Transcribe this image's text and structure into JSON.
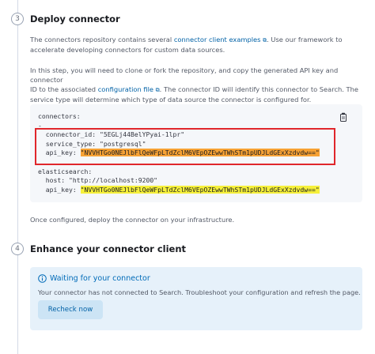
{
  "step3": {
    "number": "3",
    "title": "Deploy connector",
    "intro_part1": "The connectors repository contains several ",
    "intro_link": "connector client examples",
    "intro_part2": ". Use our framework to",
    "intro_line2": "accelerate developing connectors for custom data sources.",
    "para2_line1": "In this step, you will need to clone or fork the repository, and copy the generated API key and connector",
    "para2_line2_part1": "ID to the associated ",
    "para2_link": "configuration file",
    "para2_line2_part2": ". The connector ID will identify this connector to Search. The",
    "para2_line3": "service type will determine which type of data source the connector is configured for.",
    "code": {
      "l1": "connectors:",
      "l2": "-",
      "connector_id_key": "  connector_id: ",
      "connector_id_val": "\"5EGLj44BelYPyai-1lpr\"",
      "service_type_key": "  service_type: ",
      "service_type_val": "\"postgresql\"",
      "api_key_key": "  api_key: ",
      "api_key_val": "\"NVVHTGo0NEJlbFlQeWFpLTdZclM6VEpOZEwwTWhSTm1pUDJLdGExXzdvdw==\"",
      "es_key": "elasticsearch:",
      "host_key": "  host: ",
      "host_val": "\"http://localhost:9200\"",
      "es_api_key_key": "  api_key: ",
      "es_api_key_val": "\"NVVHTGo0NEJlbFlQeWFpLTdZclM6VEpOZEwwTWhSTm1pUDJLdGExXzdvdw==\""
    },
    "footer": "Once configured, deploy the connector on your infrastructure."
  },
  "step4": {
    "number": "4",
    "title": "Enhance your connector client",
    "callout_title": "Waiting for your connector",
    "callout_text": "Your connector has not connected to Search. Troubleshoot your configuration and refresh the page.",
    "button_label": "Recheck now"
  },
  "colors": {
    "accent": "#0061a6",
    "orange_highlight": "#f7a234",
    "yellow_highlight": "#f6f03b",
    "red_box": "#e0262b"
  }
}
